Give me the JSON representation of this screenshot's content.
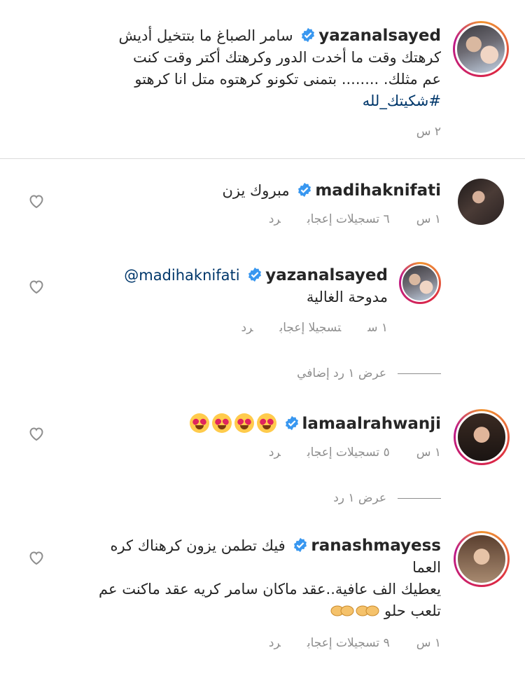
{
  "caption": {
    "username": "yazanalsayed",
    "text_line1": "سامر الصباغ ما بتتخيل أديش",
    "text_line2": "كرهتك وقت ما أخدت الدور وكرهتك أكتر وقت كنت",
    "text_line3": "عم مثلك. ........ بتمنى تكونو كرهتوه متل انا كرهتو",
    "hashtag": "#شكيتك_لله",
    "time": "٢ س"
  },
  "comments": [
    {
      "username": "madihaknifati",
      "text": "مبروك يزن",
      "time": "١ س",
      "likes": "٦ تسجيلات إعجاب",
      "reply": "رد"
    },
    {
      "username": "yazanalsayed",
      "mention": "@madihaknifati",
      "text": "مدوحة الغالية",
      "time": "١ س",
      "likes": "تسجيلا إعجاب",
      "reply": "رد"
    },
    {
      "username": "lamaalrahwanji",
      "emoji_name": "heart-eyes-emoji",
      "time": "١ س",
      "likes": "٥ تسجيلات إعجاب",
      "reply": "رد"
    },
    {
      "username": "ranashmayess",
      "text_line1": "فيك تطمن يزون كرهناك كره",
      "text_line2": "العما",
      "text_line3": "يعطيك الف عافية..عقد ماكان سامر كريه عقد ماكنت عم",
      "text_line4": "تلعب حلو",
      "emoji_name": "clapping-hands-emoji",
      "time": "١ س",
      "likes": "٩ تسجيلات إعجاب",
      "reply": "رد"
    }
  ],
  "view_replies_1": "عرض ١ رد إضافي",
  "view_replies_2": "عرض ١ رد",
  "colors": {
    "verified": "#3897f0",
    "link": "#00376b",
    "meta": "#8e8e8e",
    "divider": "#dbdbdb"
  }
}
